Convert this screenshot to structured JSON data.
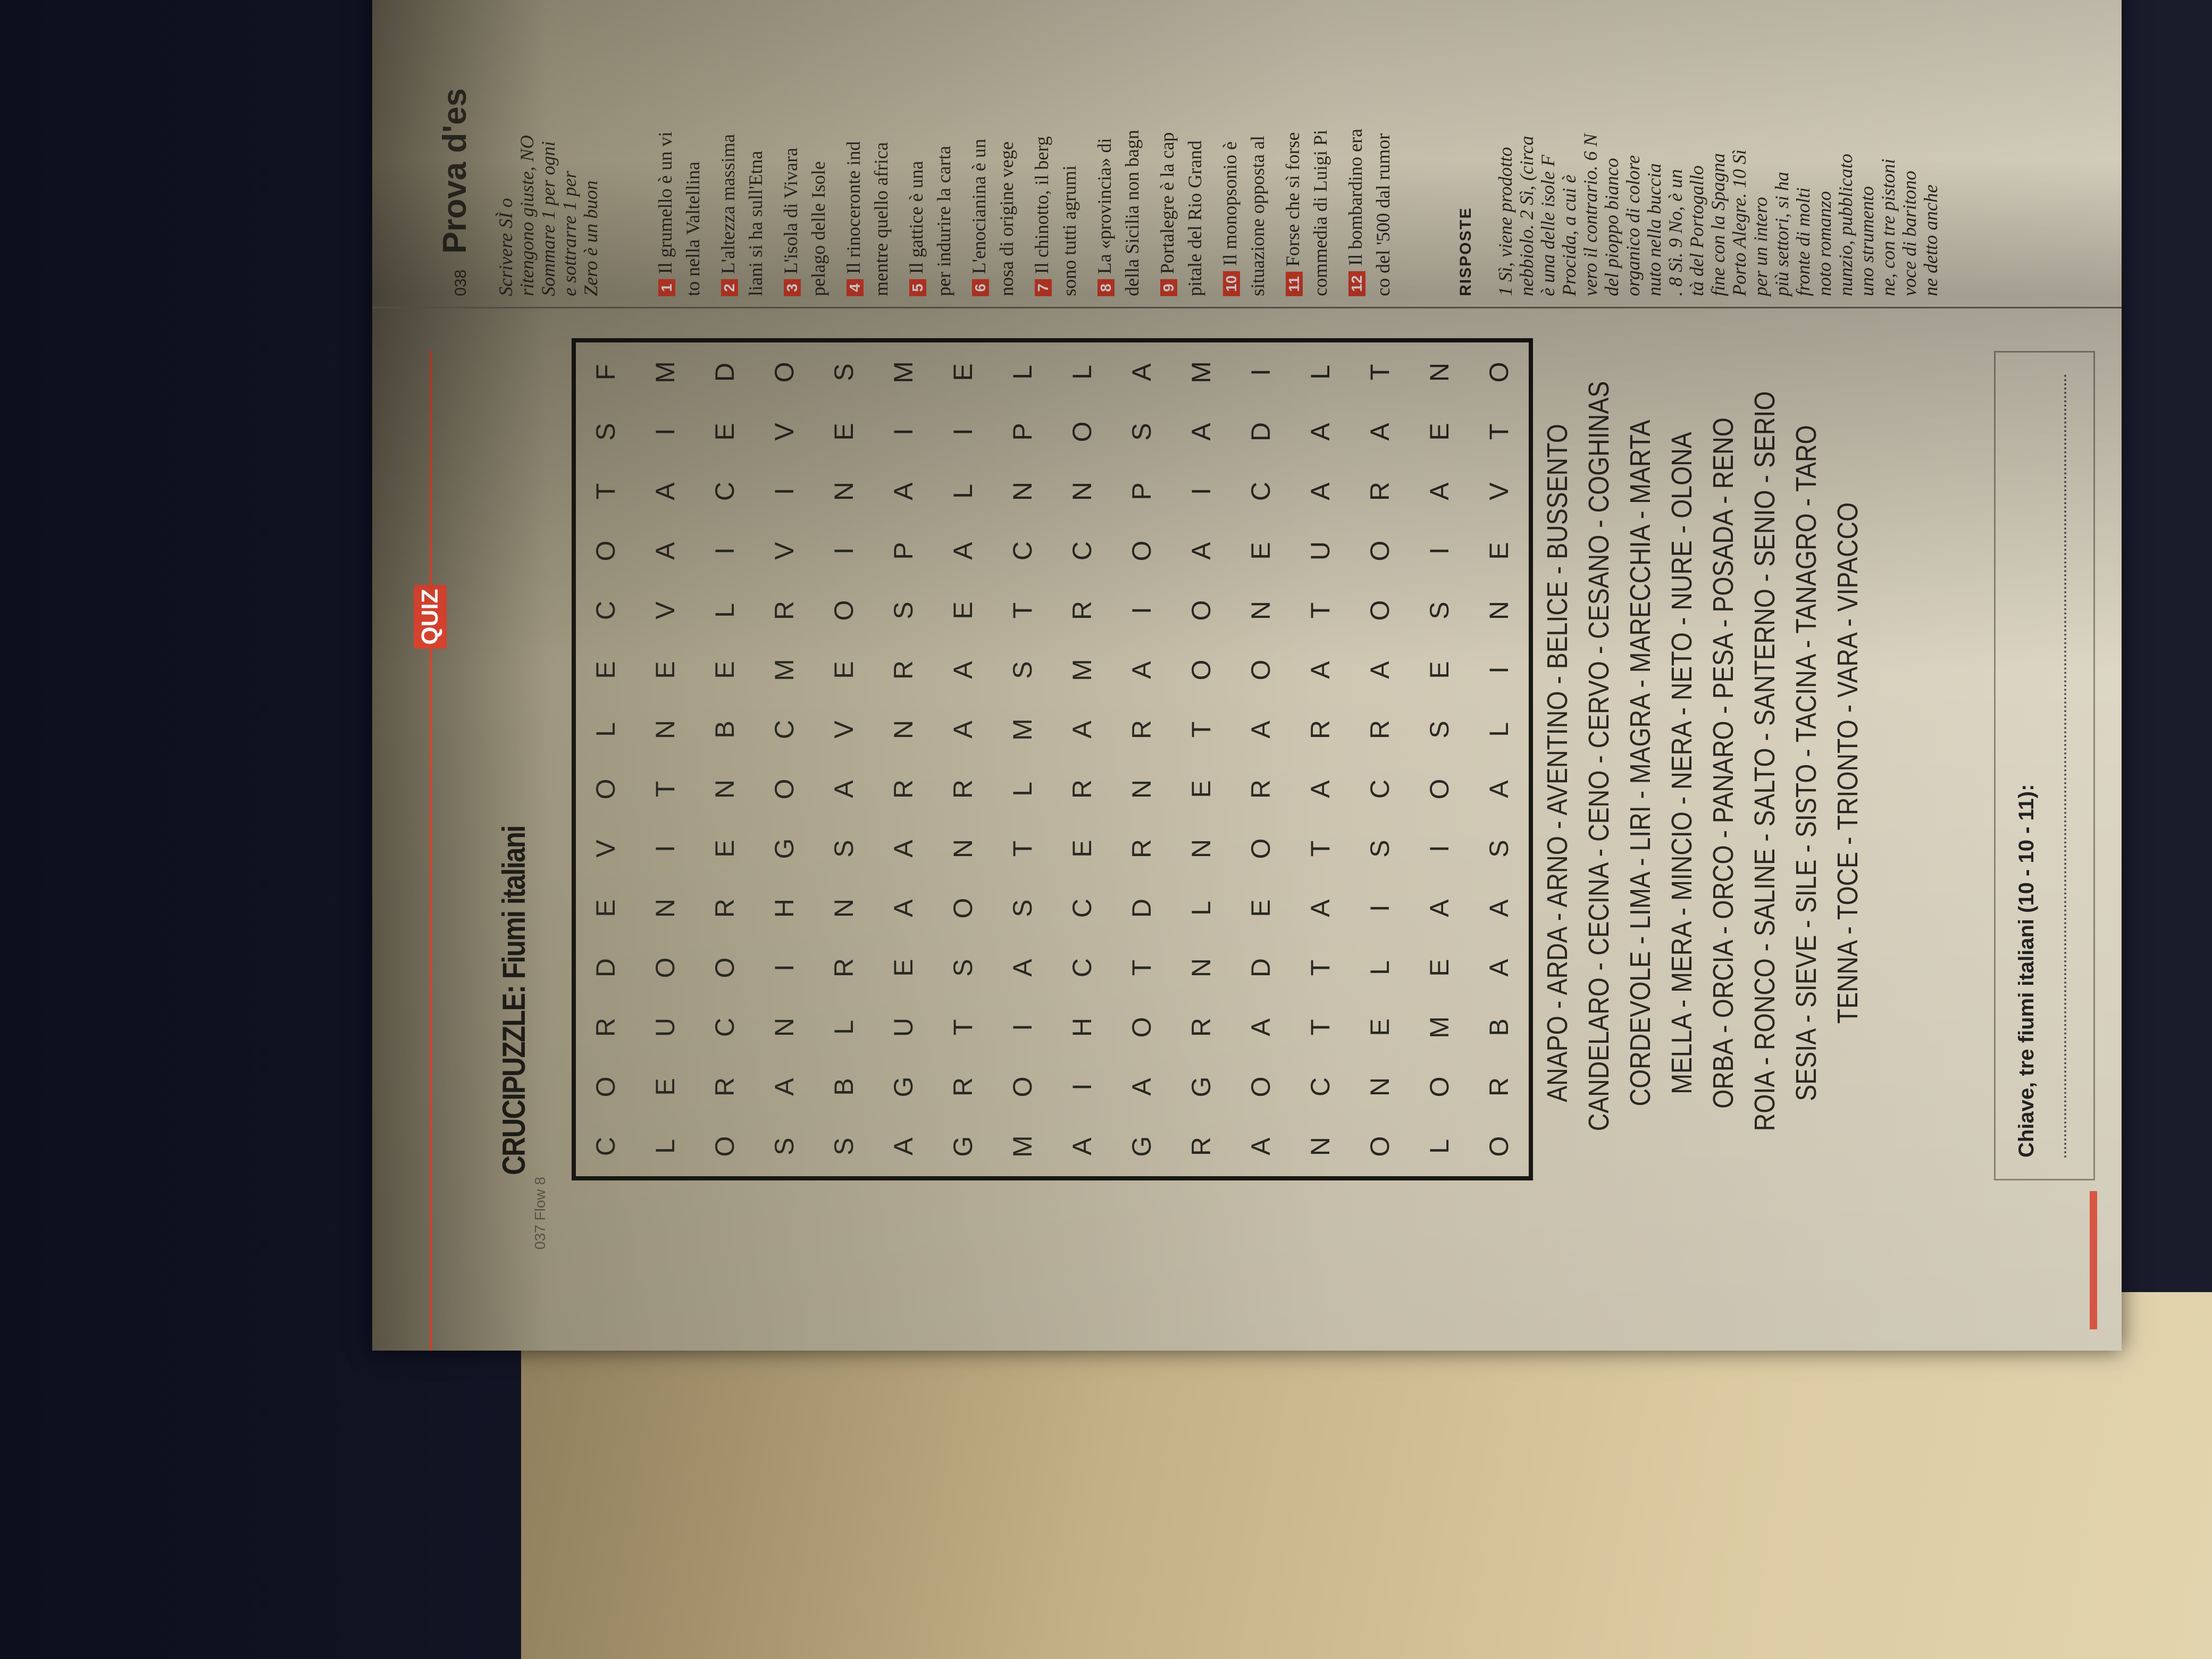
{
  "header": {
    "badge": "QUIZ",
    "folio": "037 Flow 8",
    "title": "CRUCIPUZZLE: Fiumi italiani"
  },
  "grid": [
    "CORDEVOLECOTSF",
    "LEUONITNEVAAIM",
    "ORCORENBELICED",
    "SANIHGOCMRVIVO",
    "SBLRNSAVEOINES",
    "AGUEAARNRSPAIM",
    "GRTSONRAAEALIE",
    "MOIASTLMSTCNPL",
    "AIHCCERAMRCNOL",
    "GAOTDRNRAIOPSA",
    "RGRNLNETOOAIAM",
    "AOADEORAONECDI",
    "NCTTATARATUAAL",
    "ONELISCRAOORAT",
    "LOMEAIOSESIAEN",
    "ORBAASALINEVTO"
  ],
  "word_list": [
    "ANAPO - ARDA - ARNO - AVENTINO - BELICE - BUSSENTO",
    "CANDELARO - CECINA - CENO - CERVO - CESANO - COGHINAS",
    "CORDEVOLE - LIMA - LIRI - MAGRA - MARECCHIA - MARTA",
    "MELLA - MERA - MINCIO - NERA - NETO - NURE - OLONA",
    "ORBA - ORCIA - ORCO - PANARO - PESA - POSADA - RENO",
    "ROIA - RONCO - SALINE - SALTO - SANTERNO - SENIO - SERIO",
    "SESIA - SIEVE - SILE - SISTO - TACINA - TANAGRO - TARO",
    "TENNA - TOCE - TRIONTO - VARA - VIPACCO"
  ],
  "key_label": "Chiave, tre fiumi italiani (10 - 10 - 11):",
  "right_page": {
    "page_number": "038",
    "title": "Prova d'es",
    "intro": [
      "Scrivere SÌ o",
      "ritengono giuste, NO",
      "Sommare 1 per ogni",
      "e sottrarre 1 per",
      "Zero è un buon"
    ],
    "questions": [
      {
        "n": "1",
        "lines": [
          "Il grumello è un vi",
          "to nella Valtellina"
        ]
      },
      {
        "n": "2",
        "lines": [
          "L'altezza massima",
          "liani si ha sull'Etna"
        ]
      },
      {
        "n": "3",
        "lines": [
          "L'isola di Vivara",
          "pelago delle Isole"
        ]
      },
      {
        "n": "4",
        "lines": [
          "Il rinoceronte ind",
          "mentre quello africa"
        ]
      },
      {
        "n": "5",
        "lines": [
          "Il gattice è una",
          "per indurire la carta"
        ]
      },
      {
        "n": "6",
        "lines": [
          "L'enocianina è un",
          "nosa di origine vege"
        ]
      },
      {
        "n": "7",
        "lines": [
          "Il chinotto, il berg",
          "sono tutti agrumi"
        ]
      },
      {
        "n": "8",
        "lines": [
          "La «provincia» di",
          "della Sicilia non bagn"
        ]
      },
      {
        "n": "9",
        "lines": [
          "Portalegre è la cap",
          "pitale del Rio Grand"
        ]
      },
      {
        "n": "10",
        "lines": [
          "Il monopsonio è",
          "situazione opposta al"
        ]
      },
      {
        "n": "11",
        "lines": [
          "Forse che sì forse",
          "commedia di Luigi Pi"
        ]
      },
      {
        "n": "12",
        "lines": [
          "Il bombardino era",
          "co del '500 dal rumor"
        ]
      }
    ],
    "answers_heading": "RISPOSTE",
    "answers": [
      "1 Sì, viene prodotto",
      "nebbiolo. 2 Sì, (circa",
      "è una delle isole F",
      "Procida, a cui è",
      "vero il contrario. 6 N",
      "del pioppo bianco",
      "organico di colore",
      "nuto nella buccia",
      ". 8 Sì. 9 No, è un",
      "tà del Portogallo",
      "fine con la Spagna",
      "Porto Alegre. 10 Sì",
      "per un intero",
      "più settori, si ha",
      "fronte di molti",
      "noto romanzo",
      "nunzio, pubblicato",
      "uno strumento",
      "ne, con tre pistoni",
      "voce di baritono",
      "ne detto anche"
    ]
  },
  "colors": {
    "accent": "#d9432f",
    "paper": "#d6cfbb",
    "background": "#15172a",
    "table": "#cdb98f"
  }
}
